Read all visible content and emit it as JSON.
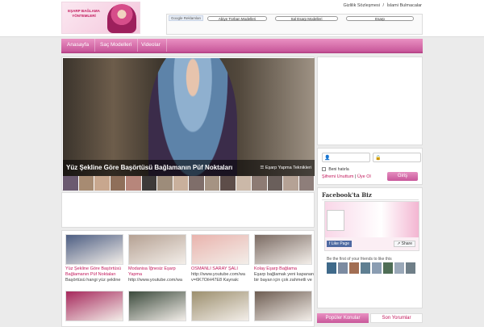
{
  "header": {
    "logo_text": "EŞARP BAĞLAMA YÖNTEMLERİ",
    "links": [
      "Gizlilik Sözleşmesi",
      "/",
      "İslami Bulmacalar"
    ]
  },
  "ads": {
    "google_label": "Google Reklamları",
    "buttons": [
      "Abiye Türban Modelleri",
      "Sal Esarp Modelleri",
      "Esarp"
    ]
  },
  "nav": {
    "items": [
      "Anasayfa",
      "Saç Modelleri",
      "Videolar"
    ]
  },
  "slider": {
    "title": "Yüz Şekline Göre Başörtüsü Bağlamanın Püf Noktaları",
    "side_label": "Eşarp Yapma Teknikleri",
    "thumb_colors": [
      "#6b5a70",
      "#a78b72",
      "#c8a78e",
      "#8f6f5a",
      "#b7867b",
      "#3d3a39",
      "#9d8c7a",
      "#c9b09c",
      "#7f6e6a",
      "#a59383",
      "#5d4d49",
      "#cbb8a8",
      "#8d7b74",
      "#6a5f5b",
      "#b5a295",
      "#8e7e7a"
    ]
  },
  "posts": [
    {
      "title": "Yüz Şekline Göre Başörtüsü Bağlamanın Püf Noktaları",
      "excerpt": "Başörtüsü hangi yüz şekline",
      "color": "#4c5d82"
    },
    {
      "title": "Modanisa İğnesiz Eşarp Yapma",
      "excerpt": "http://www.youtube.com/wa",
      "color": "#b5a193"
    },
    {
      "title": "OSMANLI SARAY ŞALI",
      "excerpt": "http://www.youtube.com/wa v=6K7OiH47E8 Kaynak:",
      "color": "#e9b3ad"
    },
    {
      "title": "Kolay Eşarp Bağlama",
      "excerpt": "Eşarp bağlamak yeni kapanan bir bayan için çok zahmetli ve",
      "color": "#7a6a62"
    },
    {
      "title": "",
      "excerpt": "",
      "color": "#a6285c"
    },
    {
      "title": "",
      "excerpt": "",
      "color": "#3b4a3c"
    },
    {
      "title": "",
      "excerpt": "",
      "color": "#9c8f6e"
    },
    {
      "title": "",
      "excerpt": "",
      "color": "#6e5d52"
    }
  ],
  "login": {
    "remember": "Beni hatırla",
    "forgot": "Şifremi Unuttum",
    "separator": "|",
    "register": "Üye Ol",
    "button": "Giriş"
  },
  "facebook": {
    "title": "Facebook'ta Biz",
    "like": "Like Page",
    "share": "Share",
    "friends": "Be the first of your friends to like this",
    "face_colors": [
      "#3f6a8a",
      "#7c8ba1",
      "#a26e53",
      "#5f7f92",
      "#8a9db2",
      "#4e6d55",
      "#9aa8b8",
      "#6f7f88"
    ]
  },
  "tabs": [
    "Popüler Konular",
    "Son Yorumlar"
  ]
}
